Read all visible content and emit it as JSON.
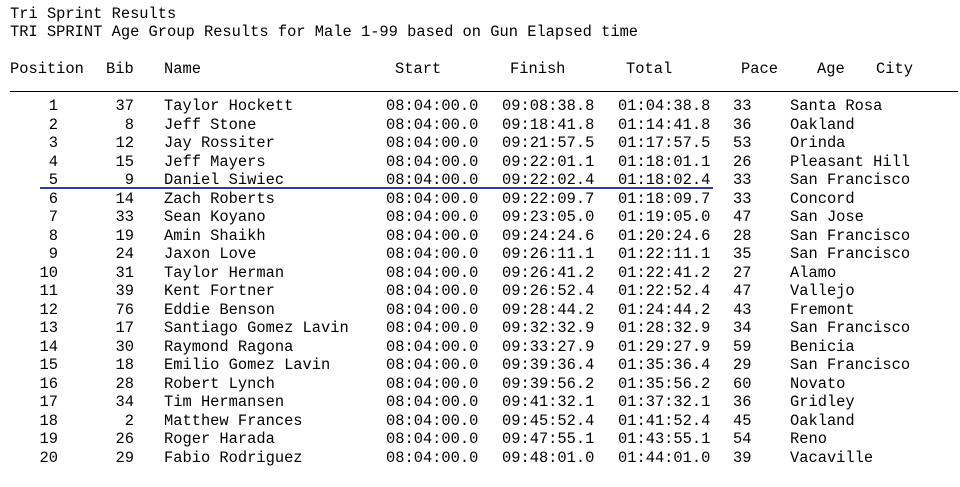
{
  "title": "Tri Sprint Results",
  "subtitle": "TRI SPRINT Age Group Results for Male 1-99 based on Gun Elapsed time",
  "headers": {
    "position": "Position",
    "bib": "Bib",
    "name": "Name",
    "start": "Start",
    "finish": "Finish",
    "total": "Total",
    "pace": "Pace",
    "age": "Age",
    "city": "City"
  },
  "separator_color": "#2b3bb0",
  "rows": [
    {
      "position": "1",
      "bib": "37",
      "name": "Taylor Hockett",
      "start": "08:04:00.0",
      "finish": "09:08:38.8",
      "total": "01:04:38.8",
      "age": "33",
      "city": "Santa Rosa"
    },
    {
      "position": "2",
      "bib": "8",
      "name": "Jeff Stone",
      "start": "08:04:00.0",
      "finish": "09:18:41.8",
      "total": "01:14:41.8",
      "age": "36",
      "city": "Oakland"
    },
    {
      "position": "3",
      "bib": "12",
      "name": "Jay Rossiter",
      "start": "08:04:00.0",
      "finish": "09:21:57.5",
      "total": "01:17:57.5",
      "age": "53",
      "city": "Orinda"
    },
    {
      "position": "4",
      "bib": "15",
      "name": "Jeff Mayers",
      "start": "08:04:00.0",
      "finish": "09:22:01.1",
      "total": "01:18:01.1",
      "age": "26",
      "city": "Pleasant Hill"
    },
    {
      "position": "5",
      "bib": "9",
      "name": "Daniel Siwiec",
      "start": "08:04:00.0",
      "finish": "09:22:02.4",
      "total": "01:18:02.4",
      "age": "33",
      "city": "San Francisco"
    },
    {
      "position": "6",
      "bib": "14",
      "name": "Zach Roberts",
      "start": "08:04:00.0",
      "finish": "09:22:09.7",
      "total": "01:18:09.7",
      "age": "33",
      "city": "Concord"
    },
    {
      "position": "7",
      "bib": "33",
      "name": "Sean Koyano",
      "start": "08:04:00.0",
      "finish": "09:23:05.0",
      "total": "01:19:05.0",
      "age": "47",
      "city": "San Jose"
    },
    {
      "position": "8",
      "bib": "19",
      "name": "Amin Shaikh",
      "start": "08:04:00.0",
      "finish": "09:24:24.6",
      "total": "01:20:24.6",
      "age": "28",
      "city": "San Francisco"
    },
    {
      "position": "9",
      "bib": "24",
      "name": "Jaxon Love",
      "start": "08:04:00.0",
      "finish": "09:26:11.1",
      "total": "01:22:11.1",
      "age": "35",
      "city": "San Francisco"
    },
    {
      "position": "10",
      "bib": "31",
      "name": "Taylor Herman",
      "start": "08:04:00.0",
      "finish": "09:26:41.2",
      "total": "01:22:41.2",
      "age": "27",
      "city": "Alamo"
    },
    {
      "position": "11",
      "bib": "39",
      "name": "Kent Fortner",
      "start": "08:04:00.0",
      "finish": "09:26:52.4",
      "total": "01:22:52.4",
      "age": "47",
      "city": "Vallejo"
    },
    {
      "position": "12",
      "bib": "76",
      "name": "Eddie Benson",
      "start": "08:04:00.0",
      "finish": "09:28:44.2",
      "total": "01:24:44.2",
      "age": "43",
      "city": "Fremont"
    },
    {
      "position": "13",
      "bib": "17",
      "name": "Santiago Gomez Lavin",
      "start": "08:04:00.0",
      "finish": "09:32:32.9",
      "total": "01:28:32.9",
      "age": "34",
      "city": "San Francisco"
    },
    {
      "position": "14",
      "bib": "30",
      "name": "Raymond Ragona",
      "start": "08:04:00.0",
      "finish": "09:33:27.9",
      "total": "01:29:27.9",
      "age": "59",
      "city": "Benicia"
    },
    {
      "position": "15",
      "bib": "18",
      "name": "Emilio Gomez Lavin",
      "start": "08:04:00.0",
      "finish": "09:39:36.4",
      "total": "01:35:36.4",
      "age": "29",
      "city": "San Francisco"
    },
    {
      "position": "16",
      "bib": "28",
      "name": "Robert Lynch",
      "start": "08:04:00.0",
      "finish": "09:39:56.2",
      "total": "01:35:56.2",
      "age": "60",
      "city": "Novato"
    },
    {
      "position": "17",
      "bib": "34",
      "name": "Tim Hermansen",
      "start": "08:04:00.0",
      "finish": "09:41:32.1",
      "total": "01:37:32.1",
      "age": "36",
      "city": "Gridley"
    },
    {
      "position": "18",
      "bib": "2",
      "name": "Matthew Frances",
      "start": "08:04:00.0",
      "finish": "09:45:52.4",
      "total": "01:41:52.4",
      "age": "45",
      "city": "Oakland"
    },
    {
      "position": "19",
      "bib": "26",
      "name": "Roger Harada",
      "start": "08:04:00.0",
      "finish": "09:47:55.1",
      "total": "01:43:55.1",
      "age": "54",
      "city": "Reno"
    },
    {
      "position": "20",
      "bib": "29",
      "name": "Fabio Rodriguez",
      "start": "08:04:00.0",
      "finish": "09:48:01.0",
      "total": "01:44:01.0",
      "age": "39",
      "city": "Vacaville"
    }
  ]
}
